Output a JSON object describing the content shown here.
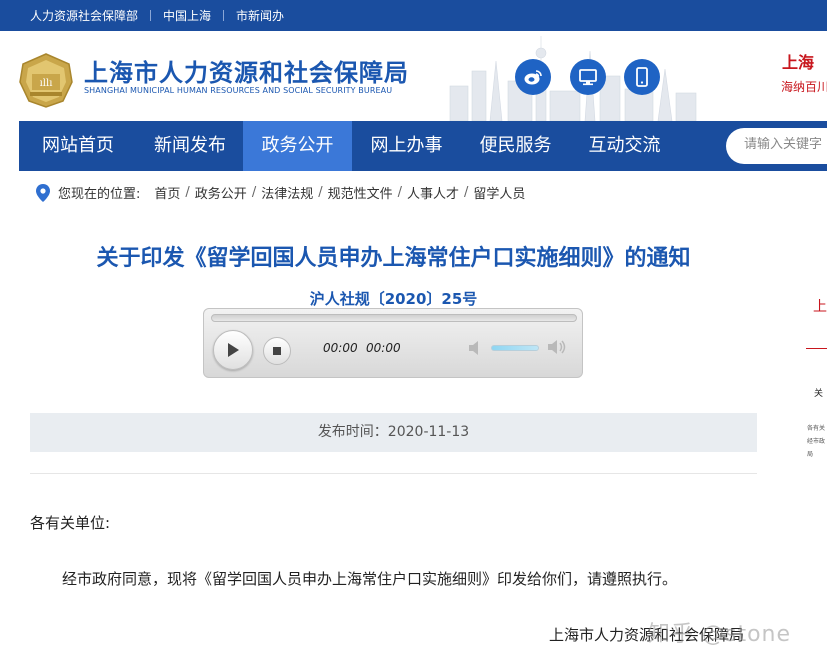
{
  "topbar": {
    "links": [
      "人力资源社会保障部",
      "中国上海",
      "市新闻办"
    ]
  },
  "header": {
    "title": "上海市人力资源和社会保障局",
    "subtitle": "SHANGHAI MUNICIPAL HUMAN RESOURCES AND SOCIAL SECURITY BUREAU",
    "social_icons": [
      "weibo-icon",
      "computer-icon",
      "mobile-icon"
    ],
    "banner_line1": "上海",
    "banner_line2": "海纳百川"
  },
  "nav": {
    "items": [
      "网站首页",
      "新闻发布",
      "政务公开",
      "网上办事",
      "便民服务",
      "互动交流"
    ],
    "active_index": 2,
    "search_placeholder": "请输入关键字"
  },
  "breadcrumb": {
    "prefix": "您现在的位置:",
    "items": [
      "首页",
      "政务公开",
      "法律法规",
      "规范性文件",
      "人事人才",
      "留学人员"
    ]
  },
  "article": {
    "title": "关于印发《留学回国人员申办上海常住户口实施细则》的通知",
    "doc_number": "沪人社规〔2020〕25号",
    "publish_time": "发布时间：2020-11-13",
    "salutation": "各有关单位:",
    "body": "经市政府同意，现将《留学回国人员申办上海常住户口实施细则》印发给你们，请遵照执行。",
    "signature": "上海市人力资源和社会保障局"
  },
  "player": {
    "current_time": "00:00",
    "duration": "00:00"
  },
  "sidebar_partial": {
    "heading": "上",
    "line2": "关",
    "small_lines": [
      "各有关",
      "经市政",
      "局"
    ]
  },
  "watermark": "知乎 @stone",
  "colors": {
    "primary_blue": "#1a4d9e",
    "active_nav": "#3b78d8",
    "title_blue": "#1b57b0",
    "accent_red": "#c8161d"
  }
}
